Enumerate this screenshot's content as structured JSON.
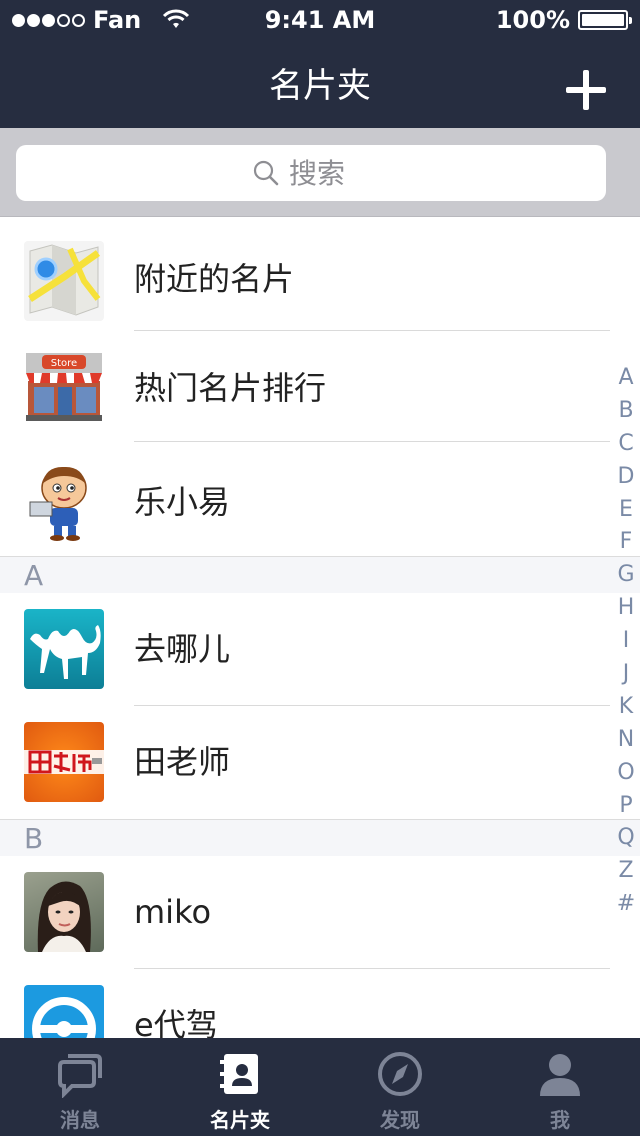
{
  "status_bar": {
    "carrier": "Fan",
    "time": "9:41 AM",
    "battery": "100%"
  },
  "nav": {
    "title": "名片夹"
  },
  "search": {
    "placeholder": "搜索"
  },
  "pinned": [
    {
      "label": "附近的名片",
      "icon": "map-icon"
    },
    {
      "label": "热门名片排行",
      "icon": "store-icon"
    },
    {
      "label": "乐小易",
      "icon": "mascot-icon"
    }
  ],
  "sections": [
    {
      "letter": "A",
      "contacts": [
        {
          "name": "去哪儿",
          "icon": "camel-icon"
        },
        {
          "name": "田老师",
          "icon": "tian-laoshi-logo"
        }
      ]
    },
    {
      "letter": "B",
      "contacts": [
        {
          "name": "miko",
          "icon": "avatar-photo"
        },
        {
          "name": "e代驾",
          "icon": "steering-wheel-icon"
        }
      ]
    }
  ],
  "index_letters": [
    "A",
    "B",
    "C",
    "D",
    "E",
    "F",
    "G",
    "H",
    "I",
    "J",
    "K",
    "N",
    "O",
    "P",
    "Q",
    "Z",
    "#"
  ],
  "tabs": [
    {
      "label": "消息",
      "icon": "chat-icon",
      "active": false
    },
    {
      "label": "名片夹",
      "icon": "contacts-book-icon",
      "active": true
    },
    {
      "label": "发现",
      "icon": "compass-icon",
      "active": false
    },
    {
      "label": "我",
      "icon": "person-icon",
      "active": false
    }
  ],
  "colors": {
    "bar_background": "#262d40",
    "search_area": "#c9c9ce",
    "index_text": "#7a8aa6",
    "tab_inactive": "#7d8496",
    "tab_active": "#ffffff"
  }
}
